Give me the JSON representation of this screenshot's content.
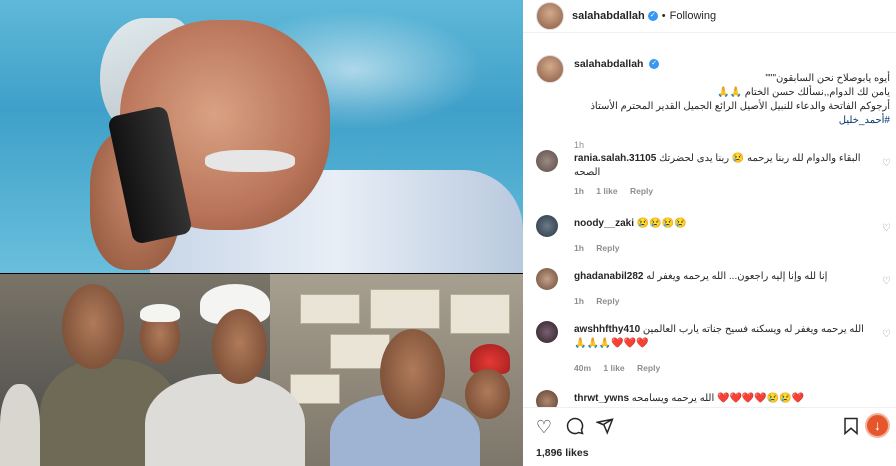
{
  "header": {
    "username": "salahabdallah",
    "verified_mark": "✓",
    "separator": "•",
    "follow_state": "Following"
  },
  "caption": {
    "username": "salahabdallah",
    "line1": "أيوه يابوصلاح نحن السابقون\"\"\"",
    "line2": "يامن لك الدوام,,نسألك حسن الختام 🙏🙏",
    "line3": "أرجوكم الفاتحة والدعاء للنبيل الأصيل الرائع الجميل القدير المحترم الأستاذ",
    "hashtag": "#أحمد_خليل",
    "time": "1h"
  },
  "comments": [
    {
      "username": "rania.salah.31105",
      "text": "البقاء والدوام لله ربنا يرحمه 😢 ربنا يدى لحضرتك الصحه",
      "time": "1h",
      "likes": "1 like",
      "reply": "Reply",
      "avatar_color": "#6b5d57"
    },
    {
      "username": "noody__zaki",
      "text": "😢😢😢😢",
      "time": "1h",
      "likes": "",
      "reply": "Reply",
      "avatar_color": "#3a4a5a"
    },
    {
      "username": "ghadanabil282",
      "text": "إنا لله وإنا إليه راجعون... الله يرحمه ويغفر له",
      "time": "1h",
      "likes": "",
      "reply": "Reply",
      "avatar_color": "#8a6a58"
    },
    {
      "username": "awshhfthy410",
      "text": "الله يرحمه ويغفر له ويسكنه فسيح جناته يارب العالمين 🙏🙏🙏❤️❤️❤️",
      "time": "40m",
      "likes": "1 like",
      "reply": "Reply",
      "avatar_color": "#4a3a48"
    },
    {
      "username": "thrwt_ywns",
      "text": "الله يرحمه ويسامحه ❤️❤️❤️❤️😢😢❤️",
      "time": "",
      "likes": "",
      "reply": "",
      "avatar_color": "#7a6252"
    }
  ],
  "actions": {
    "like_icon": "heart-icon",
    "comment_icon": "comment-icon",
    "share_icon": "share-icon",
    "save_icon": "bookmark-icon",
    "download_icon": "download-icon",
    "likes_count": "1,896 likes"
  },
  "colors": {
    "verified": "#3897f0",
    "link": "#00376b",
    "download_button": "#e5562b"
  }
}
